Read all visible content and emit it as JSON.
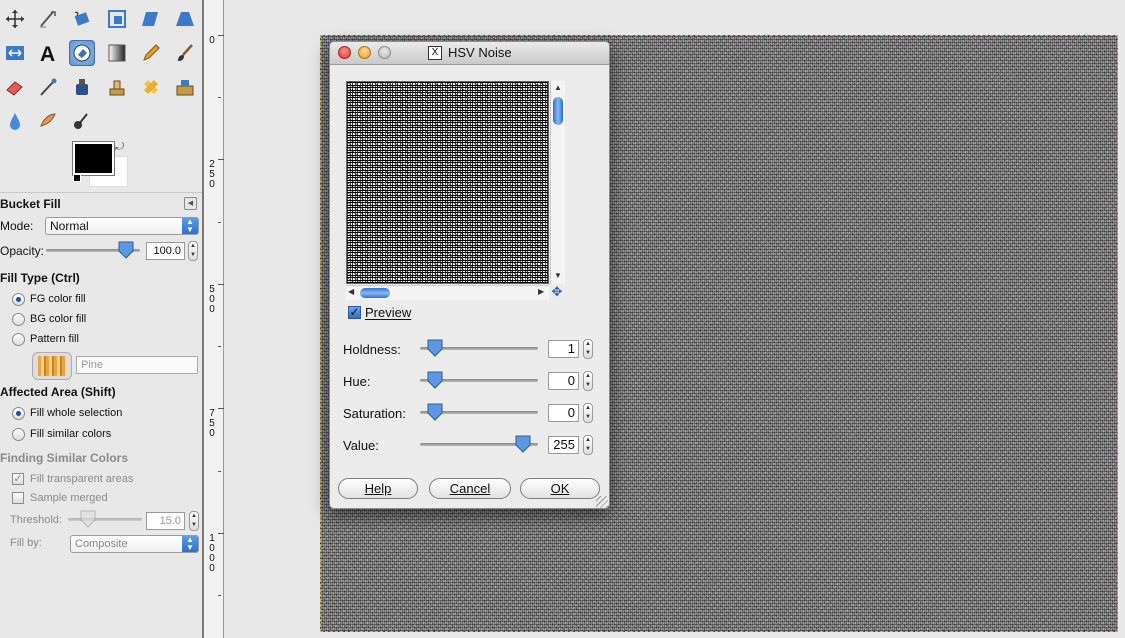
{
  "toolbox": {
    "tool_options_title": "Bucket Fill",
    "mode_label": "Mode:",
    "mode_value": "Normal",
    "opacity_label": "Opacity:",
    "opacity_value": "100.0",
    "fill_type_title": "Fill Type  (Ctrl)",
    "fill_options": [
      "FG color fill",
      "BG color fill",
      "Pattern fill"
    ],
    "pattern_name": "Pine",
    "affected_area_title": "Affected Area  (Shift)",
    "affected_options": [
      "Fill whole selection",
      "Fill similar colors"
    ],
    "finding_title": "Finding Similar Colors",
    "fill_transparent_label": "Fill transparent areas",
    "sample_merged_label": "Sample merged",
    "threshold_label": "Threshold:",
    "threshold_value": "15.0",
    "fill_by_label": "Fill by:",
    "fill_by_value": "Composite",
    "fg_color": "#000000",
    "bg_color": "#ffffff"
  },
  "ruler": {
    "labels": [
      "0",
      "2\n5\n0",
      "5\n0\n0",
      "7\n5\n0",
      "1\n0\n0\n0"
    ]
  },
  "dialog": {
    "title": "HSV Noise",
    "preview_label": "Preview",
    "params": [
      {
        "label": "Holdness:",
        "value": "1",
        "fraction": 0.03
      },
      {
        "label": "Hue:",
        "value": "0",
        "fraction": 0.0
      },
      {
        "label": "Saturation:",
        "value": "0",
        "fraction": 0.0
      },
      {
        "label": "Value:",
        "value": "255",
        "fraction": 1.0
      }
    ],
    "buttons": {
      "help": "Help",
      "cancel": "Cancel",
      "ok": "OK"
    }
  }
}
